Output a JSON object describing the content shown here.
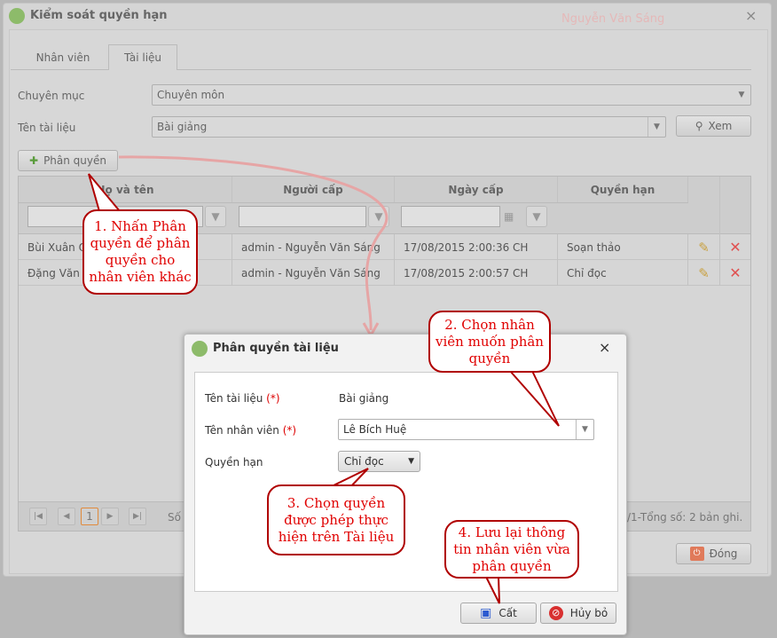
{
  "bg_watermark": [
    "Nguyễn Văn Sáng"
  ],
  "window": {
    "title": "Kiểm soát quyền hạn",
    "close": "×",
    "tabs": [
      {
        "label": "Nhân viên"
      },
      {
        "label": "Tài liệu"
      }
    ],
    "category_label": "Chuyên mục",
    "category_value": "Chuyên môn",
    "doc_label": "Tên tài liệu",
    "doc_value": "Bài giảng",
    "view_button": "Xem",
    "assign_button": "Phân quyền",
    "grid": {
      "headers": [
        "Họ và tên",
        "Người cấp",
        "Ngày cấp",
        "Quyền hạn"
      ],
      "rows": [
        {
          "name": "Bùi Xuân Q",
          "granter": "admin - Nguyễn Văn Sáng",
          "date": "17/08/2015 2:00:36 CH",
          "permission": "Soạn thảo"
        },
        {
          "name": "Đặng Văn T",
          "granter": "admin - Nguyễn Văn Sáng",
          "date": "17/08/2015 2:00:57 CH",
          "permission": "Chỉ đọc"
        }
      ]
    },
    "pager": {
      "page": "1",
      "left_text": "Số",
      "right_text": "/1-Tổng số: 2 bản ghi."
    },
    "close_button": "Đóng"
  },
  "dialog": {
    "title": "Phân quyền tài liệu",
    "close": "×",
    "doc_label": "Tên tài liệu",
    "doc_value": "Bài giảng",
    "emp_label": "Tên nhân viên",
    "emp_value": "Lê Bích Huệ",
    "perm_label": "Quyền hạn",
    "perm_value": "Chỉ đọc",
    "required": "(*)",
    "save": "Cất",
    "cancel": "Hủy bỏ"
  },
  "callouts": [
    "1. Nhấn Phân quyền để phân quyền cho nhân viên khác",
    "2. Chọn nhân viên muốn phân quyền",
    "3. Chọn quyền được phép thực hiện trên Tài liệu",
    "4. Lưu lại thông tin nhân viên vừa phân quyền"
  ],
  "colors": {
    "callout": "#e00000",
    "accent": "#e08a3c"
  }
}
